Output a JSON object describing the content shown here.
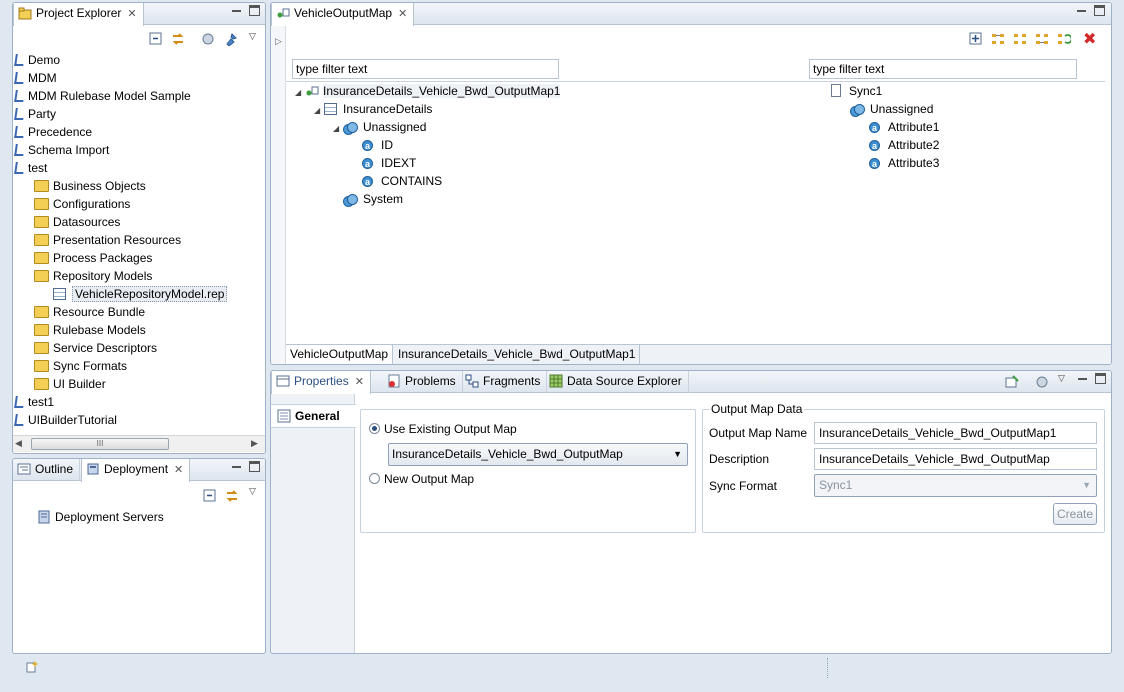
{
  "project_explorer": {
    "tab_label": "Project Explorer",
    "items": [
      {
        "label": "Demo",
        "kind": "project",
        "indent": 0
      },
      {
        "label": "MDM",
        "kind": "project",
        "indent": 0
      },
      {
        "label": "MDM Rulebase Model Sample",
        "kind": "project",
        "indent": 0
      },
      {
        "label": "Party",
        "kind": "project",
        "indent": 0
      },
      {
        "label": "Precedence",
        "kind": "project",
        "indent": 0
      },
      {
        "label": "Schema Import",
        "kind": "project",
        "indent": 0
      },
      {
        "label": "test",
        "kind": "project",
        "indent": 0
      },
      {
        "label": "Business Objects",
        "kind": "folder",
        "indent": 1
      },
      {
        "label": "Configurations",
        "kind": "folder",
        "indent": 1
      },
      {
        "label": "Datasources",
        "kind": "folder",
        "indent": 1
      },
      {
        "label": "Presentation Resources",
        "kind": "folder",
        "indent": 1
      },
      {
        "label": "Process Packages",
        "kind": "folder",
        "indent": 1
      },
      {
        "label": "Repository Models",
        "kind": "folder",
        "indent": 1
      },
      {
        "label": "VehicleRepositoryModel.rep",
        "kind": "file",
        "indent": 2
      },
      {
        "label": "Resource Bundle",
        "kind": "folder",
        "indent": 1
      },
      {
        "label": "Rulebase Models",
        "kind": "folder",
        "indent": 1
      },
      {
        "label": "Service Descriptors",
        "kind": "folder",
        "indent": 1
      },
      {
        "label": "Sync Formats",
        "kind": "folder",
        "indent": 1
      },
      {
        "label": "UI Builder",
        "kind": "folder",
        "indent": 1
      },
      {
        "label": "test1",
        "kind": "project",
        "indent": 0
      },
      {
        "label": "UIBuilderTutorial",
        "kind": "project",
        "indent": 0
      }
    ],
    "scroll_grip": "III"
  },
  "outline_deployment": {
    "tab_outline": "Outline",
    "tab_deployment": "Deployment",
    "item": "Deployment Servers"
  },
  "editor": {
    "tab_label": "VehicleOutputMap",
    "left_filter": "type filter text",
    "right_filter": "type filter text",
    "left_tree": [
      {
        "label": "InsuranceDetails_Vehicle_Bwd_OutputMap1",
        "icon": "map",
        "level": 0,
        "arrow": "◢"
      },
      {
        "label": "InsuranceDetails",
        "icon": "table",
        "level": 1,
        "arrow": "◢"
      },
      {
        "label": "Unassigned",
        "icon": "group",
        "level": 2,
        "arrow": "◢"
      },
      {
        "label": "ID",
        "icon": "attr",
        "level": 3,
        "arrow": ""
      },
      {
        "label": "IDEXT",
        "icon": "attr",
        "level": 3,
        "arrow": ""
      },
      {
        "label": "CONTAINS",
        "icon": "attr",
        "level": 3,
        "arrow": ""
      },
      {
        "label": "System",
        "icon": "group",
        "level": 2,
        "arrow": ""
      }
    ],
    "right_tree": [
      {
        "label": "Sync1",
        "icon": "doc",
        "level": 0
      },
      {
        "label": "Unassigned",
        "icon": "group",
        "level": 1
      },
      {
        "label": "Attribute1",
        "icon": "attr",
        "level": 2
      },
      {
        "label": "Attribute2",
        "icon": "attr",
        "level": 2
      },
      {
        "label": "Attribute3",
        "icon": "attr",
        "level": 2
      }
    ],
    "bottom_tabs": [
      "VehicleOutputMap",
      "InsuranceDetails_Vehicle_Bwd_OutputMap1"
    ]
  },
  "properties": {
    "tabs": [
      "Properties",
      "Problems",
      "Fragments",
      "Data Source Explorer"
    ],
    "side_tab": "General",
    "use_existing_label": "Use Existing Output Map",
    "existing_combo_value": "InsuranceDetails_Vehicle_Bwd_OutputMap",
    "new_output_label": "New Output Map",
    "group_title": "Output Map Data",
    "name_label": "Output Map Name",
    "name_value": "InsuranceDetails_Vehicle_Bwd_OutputMap1",
    "desc_label": "Description",
    "desc_value": "InsuranceDetails_Vehicle_Bwd_OutputMap",
    "sync_label": "Sync Format",
    "sync_value": "Sync1",
    "create_button": "Create"
  }
}
